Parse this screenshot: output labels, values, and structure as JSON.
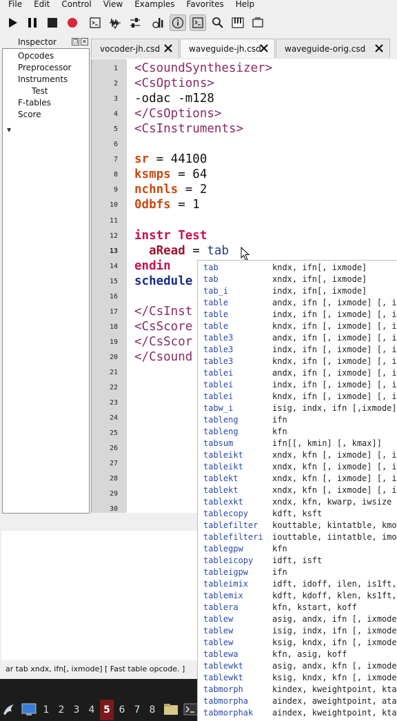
{
  "menu": [
    "File",
    "Edit",
    "Control",
    "View",
    "Examples",
    "Favorites",
    "Help"
  ],
  "toolbar": [
    {
      "icon": "play-icon"
    },
    {
      "icon": "pause-icon"
    },
    {
      "icon": "stop-icon"
    },
    {
      "icon": "record-icon"
    },
    {
      "icon": "terminal-icon"
    },
    {
      "icon": "waveform-icon"
    },
    {
      "icon": "sliders-icon"
    },
    {
      "icon": "tuning-icon"
    },
    {
      "icon": "info-icon",
      "active": true
    },
    {
      "icon": "console-icon",
      "active": true
    },
    {
      "icon": "search-icon"
    },
    {
      "icon": "keyboard-icon"
    },
    {
      "icon": "window-icon"
    }
  ],
  "inspector": {
    "title": "Inspector",
    "items": [
      {
        "label": "Opcodes",
        "level": 0
      },
      {
        "label": "Preprocessor",
        "level": 0
      },
      {
        "label": "Instruments",
        "level": 0,
        "expanded": true
      },
      {
        "label": "Test",
        "level": 1
      },
      {
        "label": "F-tables",
        "level": 0
      },
      {
        "label": "Score",
        "level": 0
      }
    ]
  },
  "tabs": [
    {
      "label": "vocoder-jh.csd",
      "active": false
    },
    {
      "label": "waveguide-jh.csd",
      "active": true
    },
    {
      "label": "waveguide-orig.csd",
      "active": false
    }
  ],
  "editor": {
    "line_count": 30,
    "current_line": 13,
    "lines": [
      [
        {
          "c": "tag",
          "t": "<CsoundSynthesizer>"
        }
      ],
      [
        {
          "c": "tag",
          "t": "<CsOptions>"
        }
      ],
      [
        {
          "c": "pl",
          "t": "-odac -m128"
        }
      ],
      [
        {
          "c": "tag",
          "t": "</CsOptions>"
        }
      ],
      [
        {
          "c": "tag",
          "t": "<CsInstruments>"
        }
      ],
      [],
      [
        {
          "c": "kw",
          "t": "sr"
        },
        {
          "c": "pl",
          "t": " = 44100"
        }
      ],
      [
        {
          "c": "kw",
          "t": "ksmps"
        },
        {
          "c": "pl",
          "t": " = 64"
        }
      ],
      [
        {
          "c": "kw",
          "t": "nchnls"
        },
        {
          "c": "pl",
          "t": " = 2"
        }
      ],
      [
        {
          "c": "kw",
          "t": "0dbfs"
        },
        {
          "c": "pl",
          "t": " = 1"
        }
      ],
      [],
      [
        {
          "c": "ins",
          "t": "instr"
        },
        {
          "c": "pl",
          "t": " "
        },
        {
          "c": "ins",
          "t": "Test"
        }
      ],
      [
        {
          "c": "pl",
          "t": "  "
        },
        {
          "c": "var",
          "t": "aRead"
        },
        {
          "c": "pl",
          "t": " = "
        },
        {
          "c": "op",
          "t": "tab"
        }
      ],
      [
        {
          "c": "ins",
          "t": "endin"
        }
      ],
      [
        {
          "c": "opb",
          "t": "schedule"
        }
      ],
      [],
      [
        {
          "c": "tag",
          "t": "</CsInst"
        }
      ],
      [
        {
          "c": "tag",
          "t": "<CsScore"
        }
      ],
      [
        {
          "c": "tag",
          "t": "</CsScor"
        }
      ],
      [
        {
          "c": "tag",
          "t": "</Csound"
        }
      ]
    ]
  },
  "completions": [
    [
      "tab",
      "kndx, ifn[, ixmode]"
    ],
    [
      "tab",
      "xndx, ifn[, ixmode]"
    ],
    [
      "tab_i",
      "indx, ifn[, ixmode]"
    ],
    [
      "table",
      "andx, ifn [, ixmode] [, ix"
    ],
    [
      "table",
      "indx, ifn [, ixmode] [, ix"
    ],
    [
      "table",
      "kndx, ifn [, ixmode] [, ix"
    ],
    [
      "table3",
      "andx, ifn [, ixmode] [, ix"
    ],
    [
      "table3",
      "indx, ifn [, ixmode] [, ix"
    ],
    [
      "table3",
      "kndx, ifn [, ixmode] [, ix"
    ],
    [
      "tablei",
      "andx, ifn [, ixmode] [, ix"
    ],
    [
      "tablei",
      "indx, ifn [, ixmode] [, ix"
    ],
    [
      "tablei",
      "kndx, ifn [, ixmode] [, ix"
    ],
    [
      "tabw_i",
      "isig, indx, ifn [,ixmode]"
    ],
    [
      "tableng",
      "ifn"
    ],
    [
      "tableng",
      "kfn"
    ],
    [
      "tabsum",
      "ifn[[, kmin] [, kmax]]"
    ],
    [
      "tableikt",
      "xndx, kfn [, ixmode] [, ix"
    ],
    [
      "tableikt",
      "xndx, kfn [, ixmode] [, ix"
    ],
    [
      "tablekt",
      "xndx, kfn [, ixmode] [, ix"
    ],
    [
      "tablekt",
      "xndx, kfn [, ixmode] [, ix"
    ],
    [
      "tablexkt",
      "xndx, kfn, kwarp, iwsize"
    ],
    [
      "tablecopy",
      "kdft, ksft"
    ],
    [
      "tablefilter",
      "kouttable, kintatble, kmod"
    ],
    [
      "tablefilteri",
      "iouttable, iintatble, imod"
    ],
    [
      "tablegpw",
      "kfn"
    ],
    [
      "tableicopy",
      "idft, isft"
    ],
    [
      "tableigpw",
      "ifn"
    ],
    [
      "tableimix",
      "idft, idoff, ilen, is1ft,"
    ],
    [
      "tablemix",
      "kdft, kdoff, klen, ks1ft,"
    ],
    [
      "tablera",
      "kfn, kstart, koff"
    ],
    [
      "tablew",
      "asig, andx, ifn [, ixmode"
    ],
    [
      "tablew",
      "isig, indx, ifn [, ixmode"
    ],
    [
      "tablew",
      "ksig, kndx, ifn [, ixmode"
    ],
    [
      "tablewa",
      "kfn, asig, koff"
    ],
    [
      "tablewkt",
      "asig, andx, kfn [, ixmode"
    ],
    [
      "tablewkt",
      "ksig, kndx, kfn [, ixmode"
    ],
    [
      "tabmorph",
      "kindex, kweightpoint, ktab"
    ],
    [
      "tabmorpha",
      "aindex, aweightpoint, atab"
    ],
    [
      "tabmorphak",
      "aindex, kweightpoint, ktab"
    ]
  ],
  "status": "ar tab xndx, ifn[, ixmode] [ Fast table opcode. ]",
  "taskbar": {
    "workspaces": [
      "1",
      "2",
      "3",
      "4",
      "5",
      "6",
      "7",
      "8"
    ],
    "current": "5"
  }
}
